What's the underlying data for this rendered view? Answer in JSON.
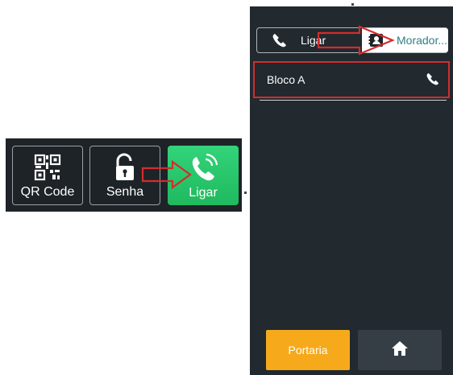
{
  "keypad": {
    "qr_label": "QR Code",
    "senha_label": "Senha",
    "ligar_label": "Ligar"
  },
  "phone": {
    "tabs": {
      "ligar_label": "Ligar",
      "morador_label": "Morador..."
    },
    "list": [
      {
        "label": "Bloco A"
      }
    ],
    "bottom": {
      "portaria_label": "Portaria"
    }
  },
  "icons": {
    "qr": "qr-code-icon",
    "senha": "unlock-icon",
    "ligar": "phone-ringing-icon",
    "tab_ligar": "phone-icon",
    "tab_morador": "contact-card-icon",
    "row_call": "phone-icon",
    "home": "home-icon"
  },
  "colors": {
    "panel_bg": "#22292f",
    "call_green": "#1fb95e",
    "portaria_orange": "#f6a91b",
    "annotation_red": "#d22d2d",
    "morador_teal": "#2d7f86"
  }
}
